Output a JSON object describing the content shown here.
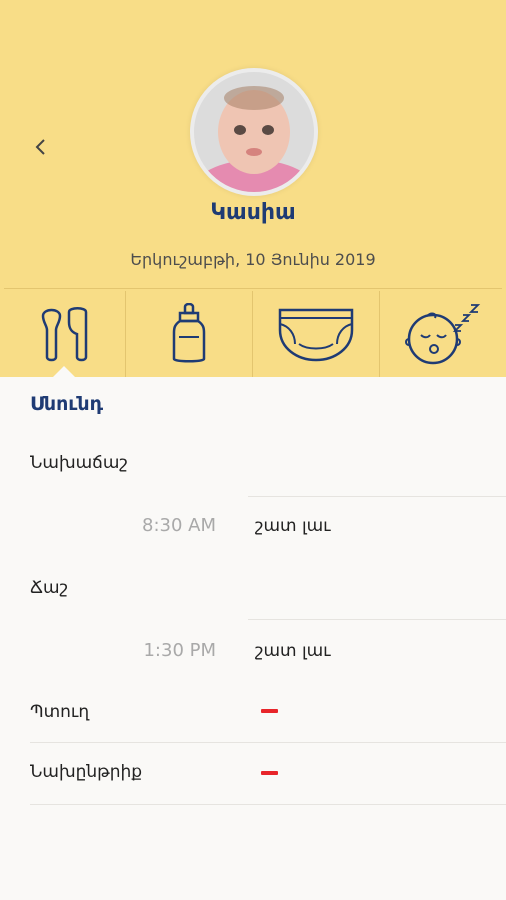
{
  "header": {
    "back_icon": "chevron-left-icon",
    "name": "Կասիա",
    "date": "Երկուշաբթի, 10 Յունիս 2019"
  },
  "tabs": [
    {
      "icon": "cutlery-icon",
      "active": true
    },
    {
      "icon": "baby-bottle-icon",
      "active": false
    },
    {
      "icon": "diaper-icon",
      "active": false
    },
    {
      "icon": "sleeping-baby-icon",
      "active": false
    }
  ],
  "section": {
    "title": "Սնունդ",
    "rows": [
      {
        "label": "Նախաճաշ",
        "time": "8:30 AM",
        "value": "շատ լաւ"
      },
      {
        "label": "Ճաշ",
        "time": "1:30 PM",
        "value": "շատ լաւ"
      },
      {
        "label": "Պտուղ",
        "value": "–"
      },
      {
        "label": "Նախընթրիք",
        "value": "–"
      }
    ]
  },
  "colors": {
    "header_bg": "#f8dd87",
    "accent": "#1f3b74",
    "dash": "#e8252a"
  }
}
